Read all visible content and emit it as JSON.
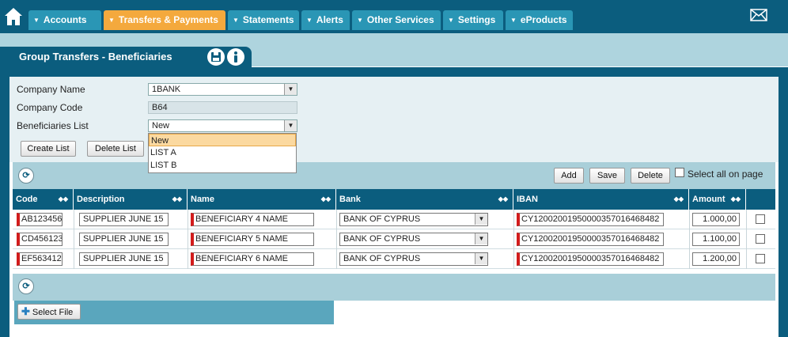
{
  "nav": {
    "tabs": [
      {
        "label": "Accounts",
        "active": false
      },
      {
        "label": "Transfers & Payments",
        "active": true
      },
      {
        "label": "Statements",
        "active": false
      },
      {
        "label": "Alerts",
        "active": false
      },
      {
        "label": "Other Services",
        "active": false
      },
      {
        "label": "Settings",
        "active": false
      },
      {
        "label": "eProducts",
        "active": false
      }
    ],
    "icons": {
      "home": "home-icon",
      "mail": "envelope-icon"
    }
  },
  "section": {
    "title": "Group Transfers - Beneficiaries",
    "icons": [
      "save-icon",
      "info-icon"
    ]
  },
  "form": {
    "company_name_label": "Company Name",
    "company_name_value": "1BANK",
    "company_code_label": "Company Code",
    "company_code_value": "B64",
    "beneficiaries_label": "Beneficiaries List",
    "beneficiaries_value": "New",
    "create_list": "Create List",
    "delete_list": "Delete List",
    "dropdown_options": [
      "New",
      "LIST A",
      "LIST B"
    ],
    "dropdown_selected": "New"
  },
  "toolbar": {
    "add": "Add",
    "save": "Save",
    "delete": "Delete",
    "select_all": "Select all on page"
  },
  "table": {
    "columns": [
      "Code",
      "Description",
      "Name",
      "Bank",
      "IBAN",
      "Amount"
    ],
    "rows": [
      {
        "code": "AB123456",
        "description": "SUPPLIER JUNE 15",
        "name": "BENEFICIARY 4 NAME",
        "bank": "BANK OF CYPRUS",
        "iban": "CY12002001950000357016468482",
        "amount": "1.000,00"
      },
      {
        "code": "CD456123",
        "description": "SUPPLIER JUNE 15",
        "name": "BENEFICIARY 5 NAME",
        "bank": "BANK OF CYPRUS",
        "iban": "CY12002001950000357016468482",
        "amount": "1.100,00"
      },
      {
        "code": "EF563412",
        "description": "SUPPLIER JUNE 15",
        "name": "BENEFICIARY 6 NAME",
        "bank": "BANK OF CYPRUS",
        "iban": "CY12002001950000357016468482",
        "amount": "1.200,00"
      }
    ]
  },
  "upload": {
    "select_file": "Select File"
  },
  "colors": {
    "primary": "#0b5d7e",
    "tab": "#2a96b5",
    "active_tab": "#f4a93d",
    "required": "#d21c1c"
  }
}
